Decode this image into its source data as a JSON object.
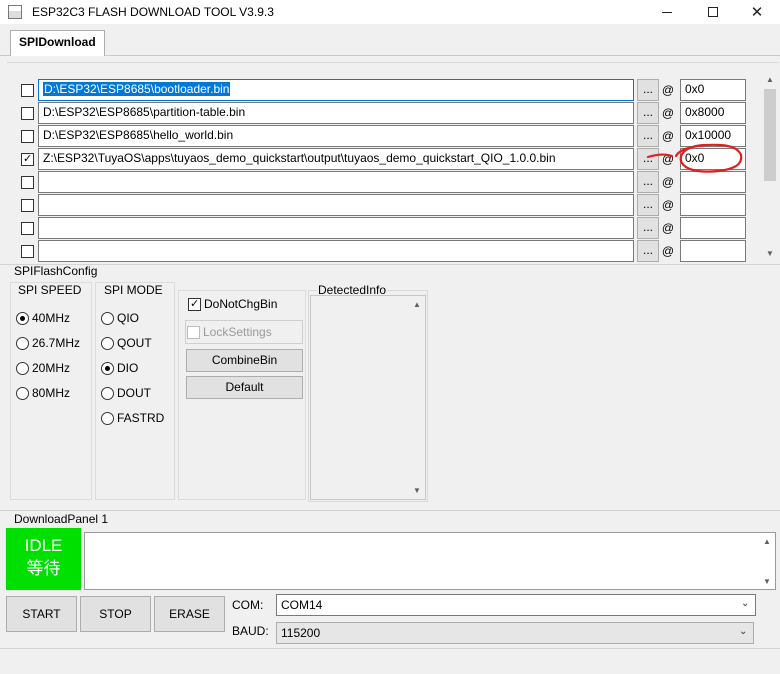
{
  "window": {
    "title": "ESP32C3 FLASH DOWNLOAD TOOL V3.9.3"
  },
  "tabs": [
    {
      "label": "SPIDownload"
    }
  ],
  "file_rows": [
    {
      "checked": false,
      "path": "D:\\ESP32\\ESP8685\\bootloader.bin",
      "address": "0x0"
    },
    {
      "checked": false,
      "path": "D:\\ESP32\\ESP8685\\partition-table.bin",
      "address": "0x8000"
    },
    {
      "checked": false,
      "path": "D:\\ESP32\\ESP8685\\hello_world.bin",
      "address": "0x10000"
    },
    {
      "checked": true,
      "path": "Z:\\ESP32\\TuyaOS\\apps\\tuyaos_demo_quickstart\\output\\tuyaos_demo_quickstart_QIO_1.0.0.bin",
      "address": "0x0"
    },
    {
      "checked": false,
      "path": "",
      "address": ""
    },
    {
      "checked": false,
      "path": "",
      "address": ""
    },
    {
      "checked": false,
      "path": "",
      "address": ""
    },
    {
      "checked": false,
      "path": "",
      "address": ""
    }
  ],
  "row_controls": {
    "browse_label": "...",
    "at_label": "@"
  },
  "spi_config": {
    "title": "SPIFlashConfig",
    "speed": {
      "title": "SPI SPEED",
      "options": [
        "40MHz",
        "26.7MHz",
        "20MHz",
        "80MHz"
      ],
      "selected": "40MHz"
    },
    "mode": {
      "title": "SPI MODE",
      "options": [
        "QIO",
        "QOUT",
        "DIO",
        "DOUT",
        "FASTRD"
      ],
      "selected": "DIO"
    },
    "do_not_chg_bin": {
      "label": "DoNotChgBin",
      "checked": true
    },
    "lock_settings": {
      "label": "LockSettings",
      "checked": false,
      "disabled": true
    },
    "combine_bin_label": "CombineBin",
    "default_label": "Default",
    "detected_info_title": "DetectedInfo"
  },
  "download_panel": {
    "title": "DownloadPanel 1",
    "status_en": "IDLE",
    "status_cn": "等待",
    "status_color": "#00e000",
    "start_label": "START",
    "stop_label": "STOP",
    "erase_label": "ERASE",
    "com_label": "COM:",
    "com_value": "COM14",
    "baud_label": "BAUD:",
    "baud_value": "115200"
  },
  "annotation_color": "#e02020"
}
